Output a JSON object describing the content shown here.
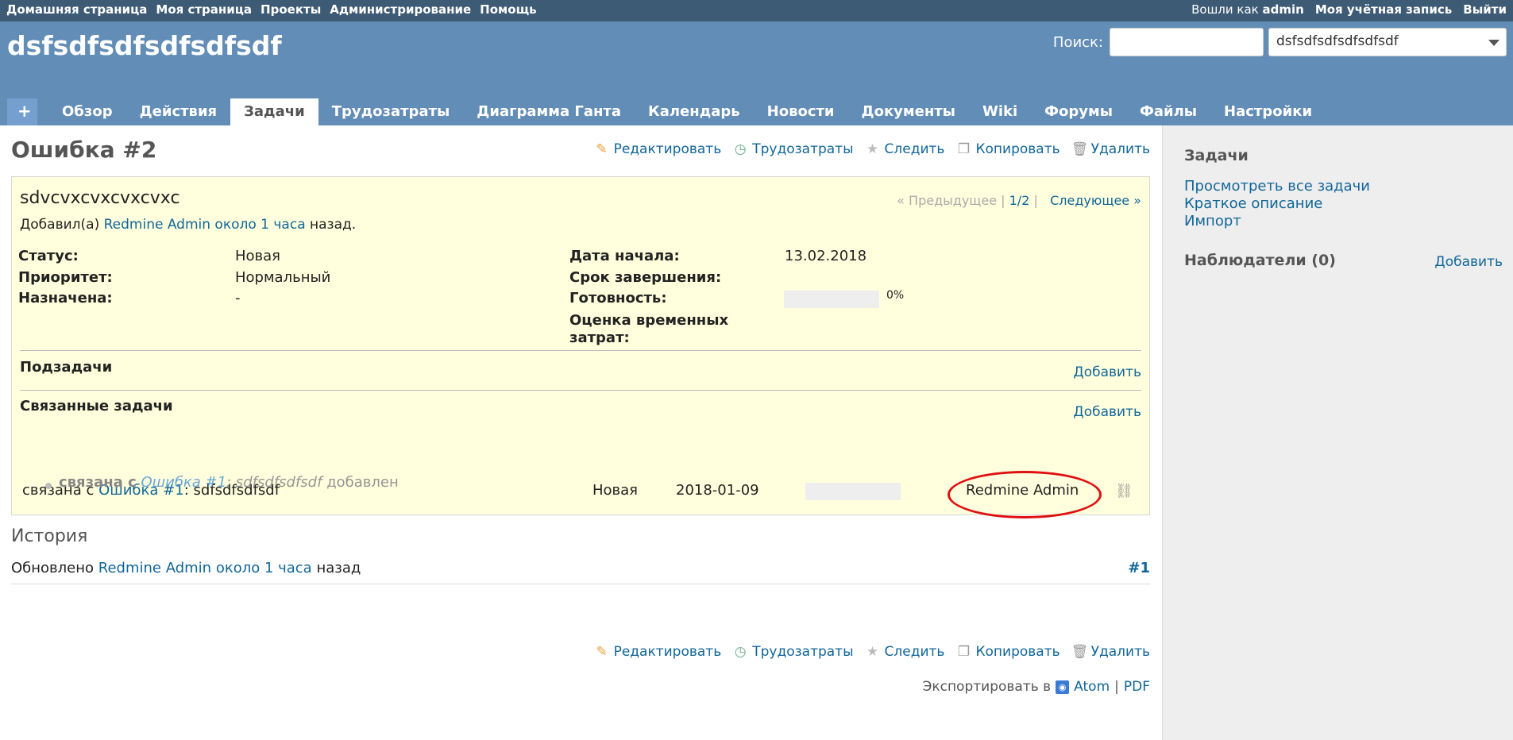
{
  "top_menu": {
    "left": [
      "Домашняя страница",
      "Моя страница",
      "Проекты",
      "Администрирование",
      "Помощь"
    ],
    "logged_as_prefix": "Вошли как",
    "logged_as_user": "admin",
    "my_account": "Моя учётная запись",
    "logout": "Выйти"
  },
  "header": {
    "project_title": "dsfsdfsdfsdfsdfsdf",
    "search_label": "Поиск:",
    "search_value": "",
    "project_jump": "dsfsdfsdfsdfsdfsdf"
  },
  "main_menu": {
    "plus": "+",
    "tabs": [
      "Обзор",
      "Действия",
      "Задачи",
      "Трудозатраты",
      "Диаграмма Ганта",
      "Календарь",
      "Новости",
      "Документы",
      "Wiki",
      "Форумы",
      "Файлы",
      "Настройки"
    ],
    "selected": "Задачи"
  },
  "issue": {
    "title": "Ошибка #2",
    "actions": {
      "edit": "Редактировать",
      "log_time": "Трудозатраты",
      "watch": "Следить",
      "copy": "Копировать",
      "delete": "Удалить"
    },
    "subject": "sdvcvxcvxcvxcvxc",
    "nav": {
      "previous": "« Предыдущее",
      "position": "1/2",
      "sep": "|",
      "next": "Следующее »"
    },
    "author": {
      "prefix": "Добавил(а)",
      "user": "Redmine Admin",
      "time": "около 1 часа",
      "suffix": "назад."
    },
    "attributes": {
      "status_label": "Статус:",
      "status_value": "Новая",
      "priority_label": "Приоритет:",
      "priority_value": "Нормальный",
      "assigned_label": "Назначена:",
      "assigned_value": "-",
      "start_label": "Дата начала:",
      "start_value": "13.02.2018",
      "due_label": "Срок завершения:",
      "done_label": "Готовность:",
      "done_value": "0%",
      "done_ratio": 0,
      "estimate_label_1": "Оценка временных",
      "estimate_label_2": "затрат:"
    },
    "subtasks": {
      "title": "Подзадачи",
      "add": "Добавить"
    },
    "relations": {
      "title": "Связанные задачи",
      "add": "Добавить",
      "row": {
        "relation": "связана с",
        "issue_link": "Ошибка #1",
        "colon_subject": ": sdfsdfsdfsdf",
        "status": "Новая",
        "date": "2018-01-09",
        "done_ratio": 0,
        "assignee": "Redmine Admin"
      }
    }
  },
  "history": {
    "title": "История",
    "journal": {
      "prefix": "Обновлено",
      "user": "Redmine Admin",
      "time": "около 1 часа",
      "suffix": "назад",
      "number": "#1",
      "detail_prop": "связана с",
      "detail_link": "Ошибка #1",
      "detail_value": ": sdfsdfsdfsdf",
      "detail_suffix": "добавлен"
    }
  },
  "export": {
    "label": "Экспортировать в",
    "atom": "Atom",
    "sep": "|",
    "pdf": "PDF"
  },
  "sidebar": {
    "title": "Задачи",
    "links": [
      "Просмотреть все задачи",
      "Краткое описание",
      "Импорт"
    ],
    "watchers": "Наблюдатели (0)",
    "watchers_add": "Добавить"
  }
}
